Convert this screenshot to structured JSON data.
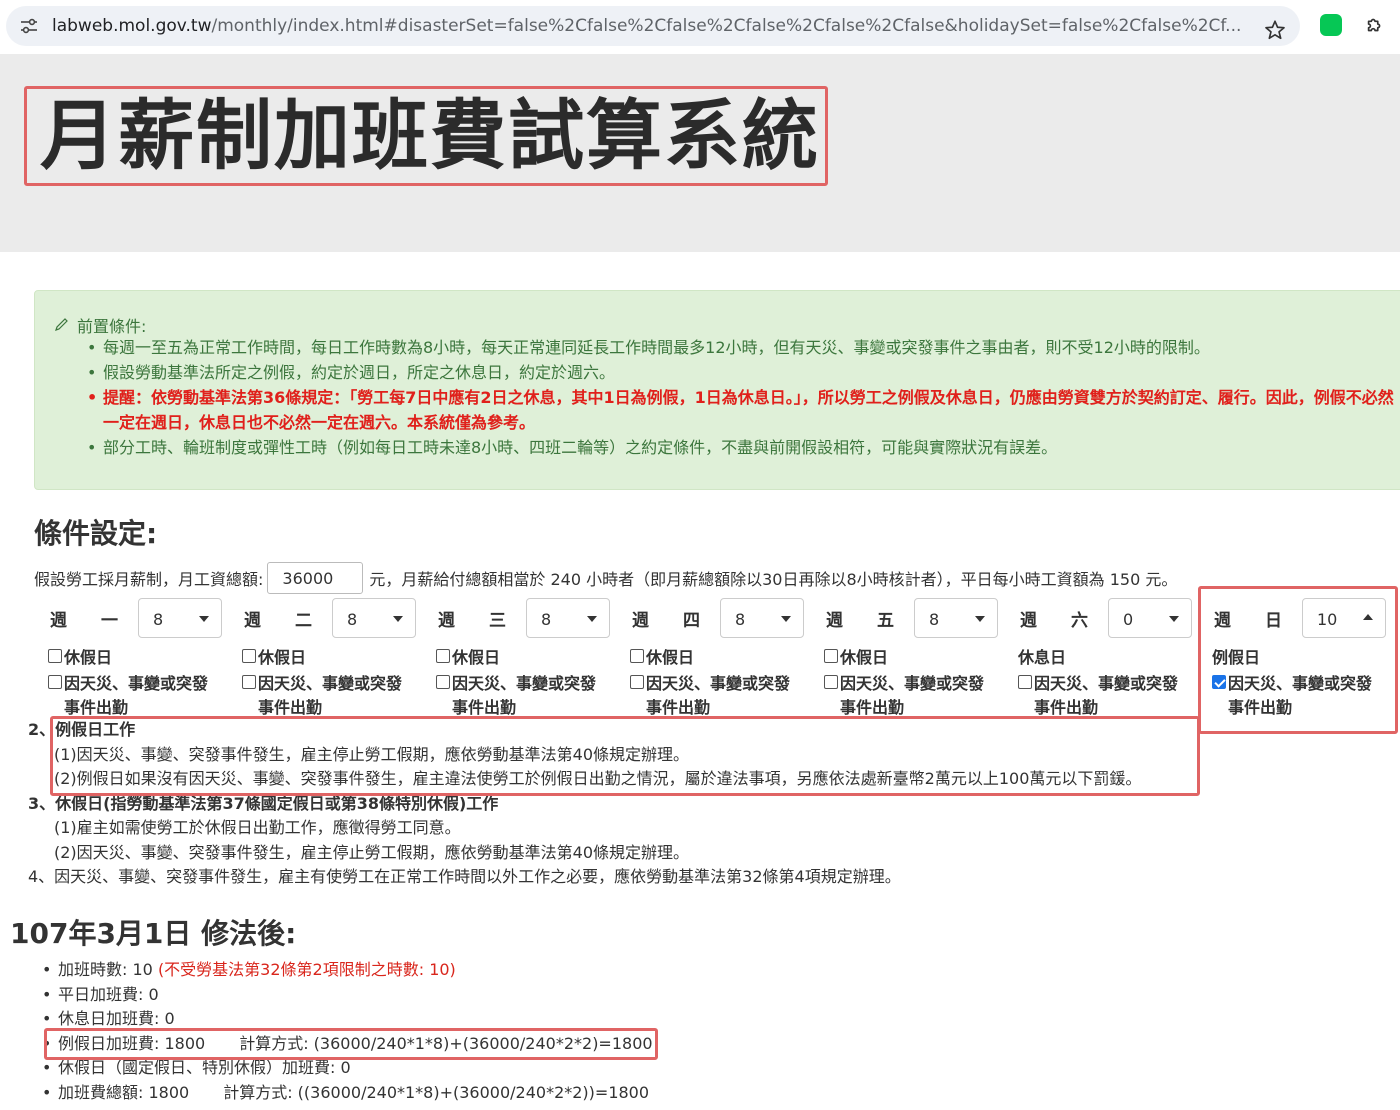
{
  "browser": {
    "url_host": "labweb.mol.gov.tw",
    "url_path": "/monthly/index.html#disasterSet=false%2Cfalse%2Cfalse%2Cfalse%2Cfalse%2Cfalse&holidaySet=false%2Cfalse%2Cf..."
  },
  "header": {
    "title": "月薪制加班費試算系統"
  },
  "preconditions": {
    "heading": "前置條件:",
    "items": [
      "每週一至五為正常工作時間，每日工作時數為8小時，每天正常連同延長工作時間最多12小時，但有天災、事變或突發事件之事由者，則不受12小時的限制。",
      "假設勞動基準法所定之例假，約定於週日，所定之休息日，約定於週六。",
      "提醒：依勞動基準法第36條規定：「勞工每7日中應有2日之休息，其中1日為例假，1日為休息日。」，所以勞工之例假及休息日，仍應由勞資雙方於契約訂定、履行。因此，例假不必然一定在週日，休息日也不必然一定在週六。本系統僅為參考。",
      "部分工時、輪班制度或彈性工時（例如每日工時未達8小時、四班二輪等）之約定條件，不盡與前開假設相符，可能與實際狀況有誤差。"
    ]
  },
  "settings": {
    "title": "條件設定:",
    "salary_prefix": "假設勞工採月薪制，月工資總額:",
    "salary_value": "36000",
    "salary_suffix": "元，月薪給付總額相當於 240 小時者（即月薪總額除以30日再除以8小時核計者），平日每小時工資額為 150 元。",
    "days": [
      {
        "c1": "週",
        "c2": "一",
        "hours": "8",
        "check1": "休假日",
        "check2a": "因天災、事變或突發",
        "check2b": "事件出勤"
      },
      {
        "c1": "週",
        "c2": "二",
        "hours": "8",
        "check1": "休假日",
        "check2a": "因天災、事變或突發",
        "check2b": "事件出勤"
      },
      {
        "c1": "週",
        "c2": "三",
        "hours": "8",
        "check1": "休假日",
        "check2a": "因天災、事變或突發",
        "check2b": "事件出勤"
      },
      {
        "c1": "週",
        "c2": "四",
        "hours": "8",
        "check1": "休假日",
        "check2a": "因天災、事變或突發",
        "check2b": "事件出勤"
      },
      {
        "c1": "週",
        "c2": "五",
        "hours": "8",
        "check1": "休假日",
        "check2a": "因天災、事變或突發",
        "check2b": "事件出勤"
      },
      {
        "c1": "週",
        "c2": "六",
        "hours": "0",
        "check1": "休息日",
        "check2a": "因天災、事變或突發",
        "check2b": "事件出勤"
      },
      {
        "c1": "週",
        "c2": "日",
        "hours": "10",
        "check1": "例假日",
        "check2a": "因天災、事變或突發",
        "check2b": "事件出勤",
        "disaster_checked": true
      }
    ]
  },
  "notes": {
    "n2": "2、例假日工作",
    "n2a": "(1)因天災、事變、突發事件發生，雇主停止勞工假期，應依勞動基準法第40條規定辦理。",
    "n2b": "(2)例假日如果沒有因天災、事變、突發事件發生，雇主違法使勞工於例假日出勤之情況，屬於違法事項，另應依法處新臺幣2萬元以上100萬元以下罰鍰。",
    "n3": "3、休假日(指勞動基準法第37條國定假日或第38條特別休假)工作",
    "n3a": "(1)雇主如需使勞工於休假日出勤工作，應徵得勞工同意。",
    "n3b": "(2)因天災、事變、突發事件發生，雇主停止勞工假期，應依勞動基準法第40條規定辦理。",
    "n4": "4、因天災、事變、突發事件發生，雇主有使勞工在正常工作時間以外工作之必要，應依勞動基準法第32條第4項規定辦理。"
  },
  "results": {
    "title": "107年3月1日 修法後:",
    "overtime_hours_label": "加班時數: 10",
    "overtime_hours_note": "(不受勞基法第32條第2項限制之時數: 10)",
    "weekday_pay": "平日加班費: 0",
    "restday_pay": "休息日加班費: 0",
    "regular_leave_pay": "例假日加班費: 1800",
    "regular_leave_formula": "計算方式: (36000/240*1*8)+(36000/240*2*2)=1800",
    "holiday_pay": "休假日（國定假日、特別休假）加班費: 0",
    "total_pay": "加班費總額: 1800",
    "total_formula": "計算方式: ((36000/240*1*8)+(36000/240*2*2))=1800"
  },
  "colors": {
    "highlight_box": "#e06464",
    "panel_bg": "#dff0d8",
    "panel_text": "#3c763d",
    "warn_text": "#e0201b"
  }
}
